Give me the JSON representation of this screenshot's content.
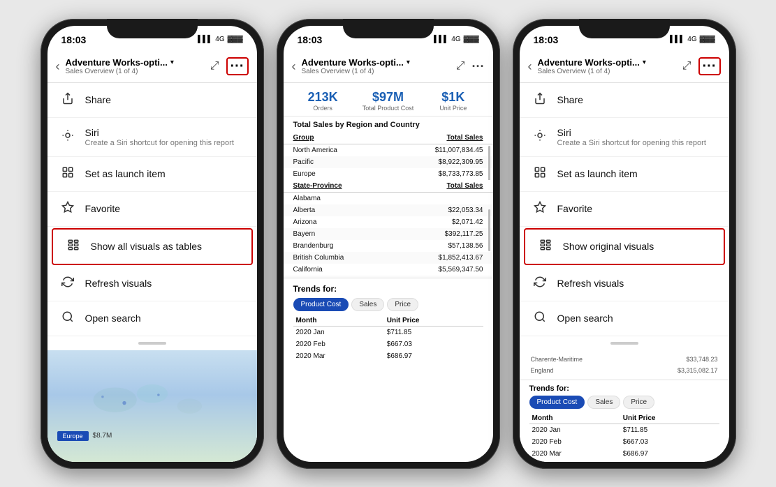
{
  "phone1": {
    "status_time": "18:03",
    "status_signal": "4G",
    "nav_title": "Adventure Works-opti...",
    "nav_subtitle": "Sales Overview (1 of 4)",
    "menu_items": [
      {
        "id": "share",
        "icon": "share",
        "label": "Share",
        "sublabel": ""
      },
      {
        "id": "siri",
        "icon": "siri",
        "label": "Siri",
        "sublabel": "Create a Siri shortcut for opening this report"
      },
      {
        "id": "launch",
        "icon": "launch",
        "label": "Set as launch item",
        "sublabel": ""
      },
      {
        "id": "favorite",
        "icon": "favorite",
        "label": "Favorite",
        "sublabel": ""
      },
      {
        "id": "show-tables",
        "icon": "tables",
        "label": "Show all visuals as tables",
        "sublabel": "",
        "highlighted": true
      },
      {
        "id": "refresh",
        "icon": "refresh",
        "label": "Refresh visuals",
        "sublabel": ""
      },
      {
        "id": "search",
        "icon": "search",
        "label": "Open search",
        "sublabel": ""
      }
    ],
    "report_bg": {
      "bar_label": "Europe",
      "bar_value": "$8.7M"
    }
  },
  "phone2": {
    "status_time": "18:03",
    "status_signal": "4G",
    "nav_title": "Adventure Works-opti...",
    "nav_subtitle": "Sales Overview (1 of 4)",
    "metrics": [
      {
        "value": "213K",
        "label": "Orders"
      },
      {
        "value": "$97M",
        "label": "Total Product Cost"
      },
      {
        "value": "$1K",
        "label": "Unit Price"
      }
    ],
    "section_title": "Total Sales by Region and Country",
    "table_headers": [
      "Group",
      "Total Sales"
    ],
    "table_rows": [
      [
        "North America",
        "$11,007,834.45"
      ],
      [
        "Pacific",
        "$8,922,309.95"
      ],
      [
        "Europe",
        "$8,733,773.85"
      ]
    ],
    "table2_headers": [
      "State-Province",
      "Total Sales"
    ],
    "table2_rows": [
      [
        "Alabama",
        ""
      ],
      [
        "Alberta",
        "$22,053.34"
      ],
      [
        "Arizona",
        "$2,071.42"
      ],
      [
        "Bayern",
        "$392,117.25"
      ],
      [
        "Brandenburg",
        "$57,138.56"
      ],
      [
        "British Columbia",
        "$1,852,413.67"
      ],
      [
        "California",
        "$5,569,347.50"
      ],
      [
        "Charente-Maritime",
        "$33,748.23"
      ],
      [
        "England",
        "$3,315,082.17"
      ]
    ],
    "trends_title": "Trends for:",
    "trend_tabs": [
      "Product Cost",
      "Sales",
      "Price"
    ],
    "active_tab": "Product Cost",
    "trend_headers": [
      "Month",
      "Unit Price"
    ],
    "trend_rows": [
      [
        "2020 Jan",
        "$711.85"
      ],
      [
        "2020 Feb",
        "$667.03"
      ],
      [
        "2020 Mar",
        "$686.97"
      ]
    ]
  },
  "phone3": {
    "status_time": "18:03",
    "status_signal": "4G",
    "nav_title": "Adventure Works-opti...",
    "nav_subtitle": "Sales Overview (1 of 4)",
    "menu_items": [
      {
        "id": "share",
        "icon": "share",
        "label": "Share",
        "sublabel": ""
      },
      {
        "id": "siri",
        "icon": "siri",
        "label": "Siri",
        "sublabel": "Create a Siri shortcut for opening this report"
      },
      {
        "id": "launch",
        "icon": "launch",
        "label": "Set as launch item",
        "sublabel": ""
      },
      {
        "id": "favorite",
        "icon": "favorite",
        "label": "Favorite",
        "sublabel": ""
      },
      {
        "id": "show-original",
        "icon": "tables",
        "label": "Show original visuals",
        "sublabel": "",
        "highlighted": true
      },
      {
        "id": "refresh",
        "icon": "refresh",
        "label": "Refresh visuals",
        "sublabel": ""
      },
      {
        "id": "search",
        "icon": "search",
        "label": "Open search",
        "sublabel": ""
      }
    ],
    "bg_rows": [
      [
        "Charente-Maritime",
        "$33,748.23"
      ],
      [
        "England",
        "$3,315,082.17"
      ]
    ],
    "trends_title": "Trends for:",
    "trend_tabs": [
      "Product Cost",
      "Sales",
      "Price"
    ],
    "active_tab": "Product Cost",
    "trend_headers": [
      "Month",
      "Unit Price"
    ],
    "trend_rows": [
      [
        "2020 Jan",
        "$711.85"
      ],
      [
        "2020 Feb",
        "$667.03"
      ],
      [
        "2020 Mar",
        "$686.97"
      ]
    ]
  }
}
